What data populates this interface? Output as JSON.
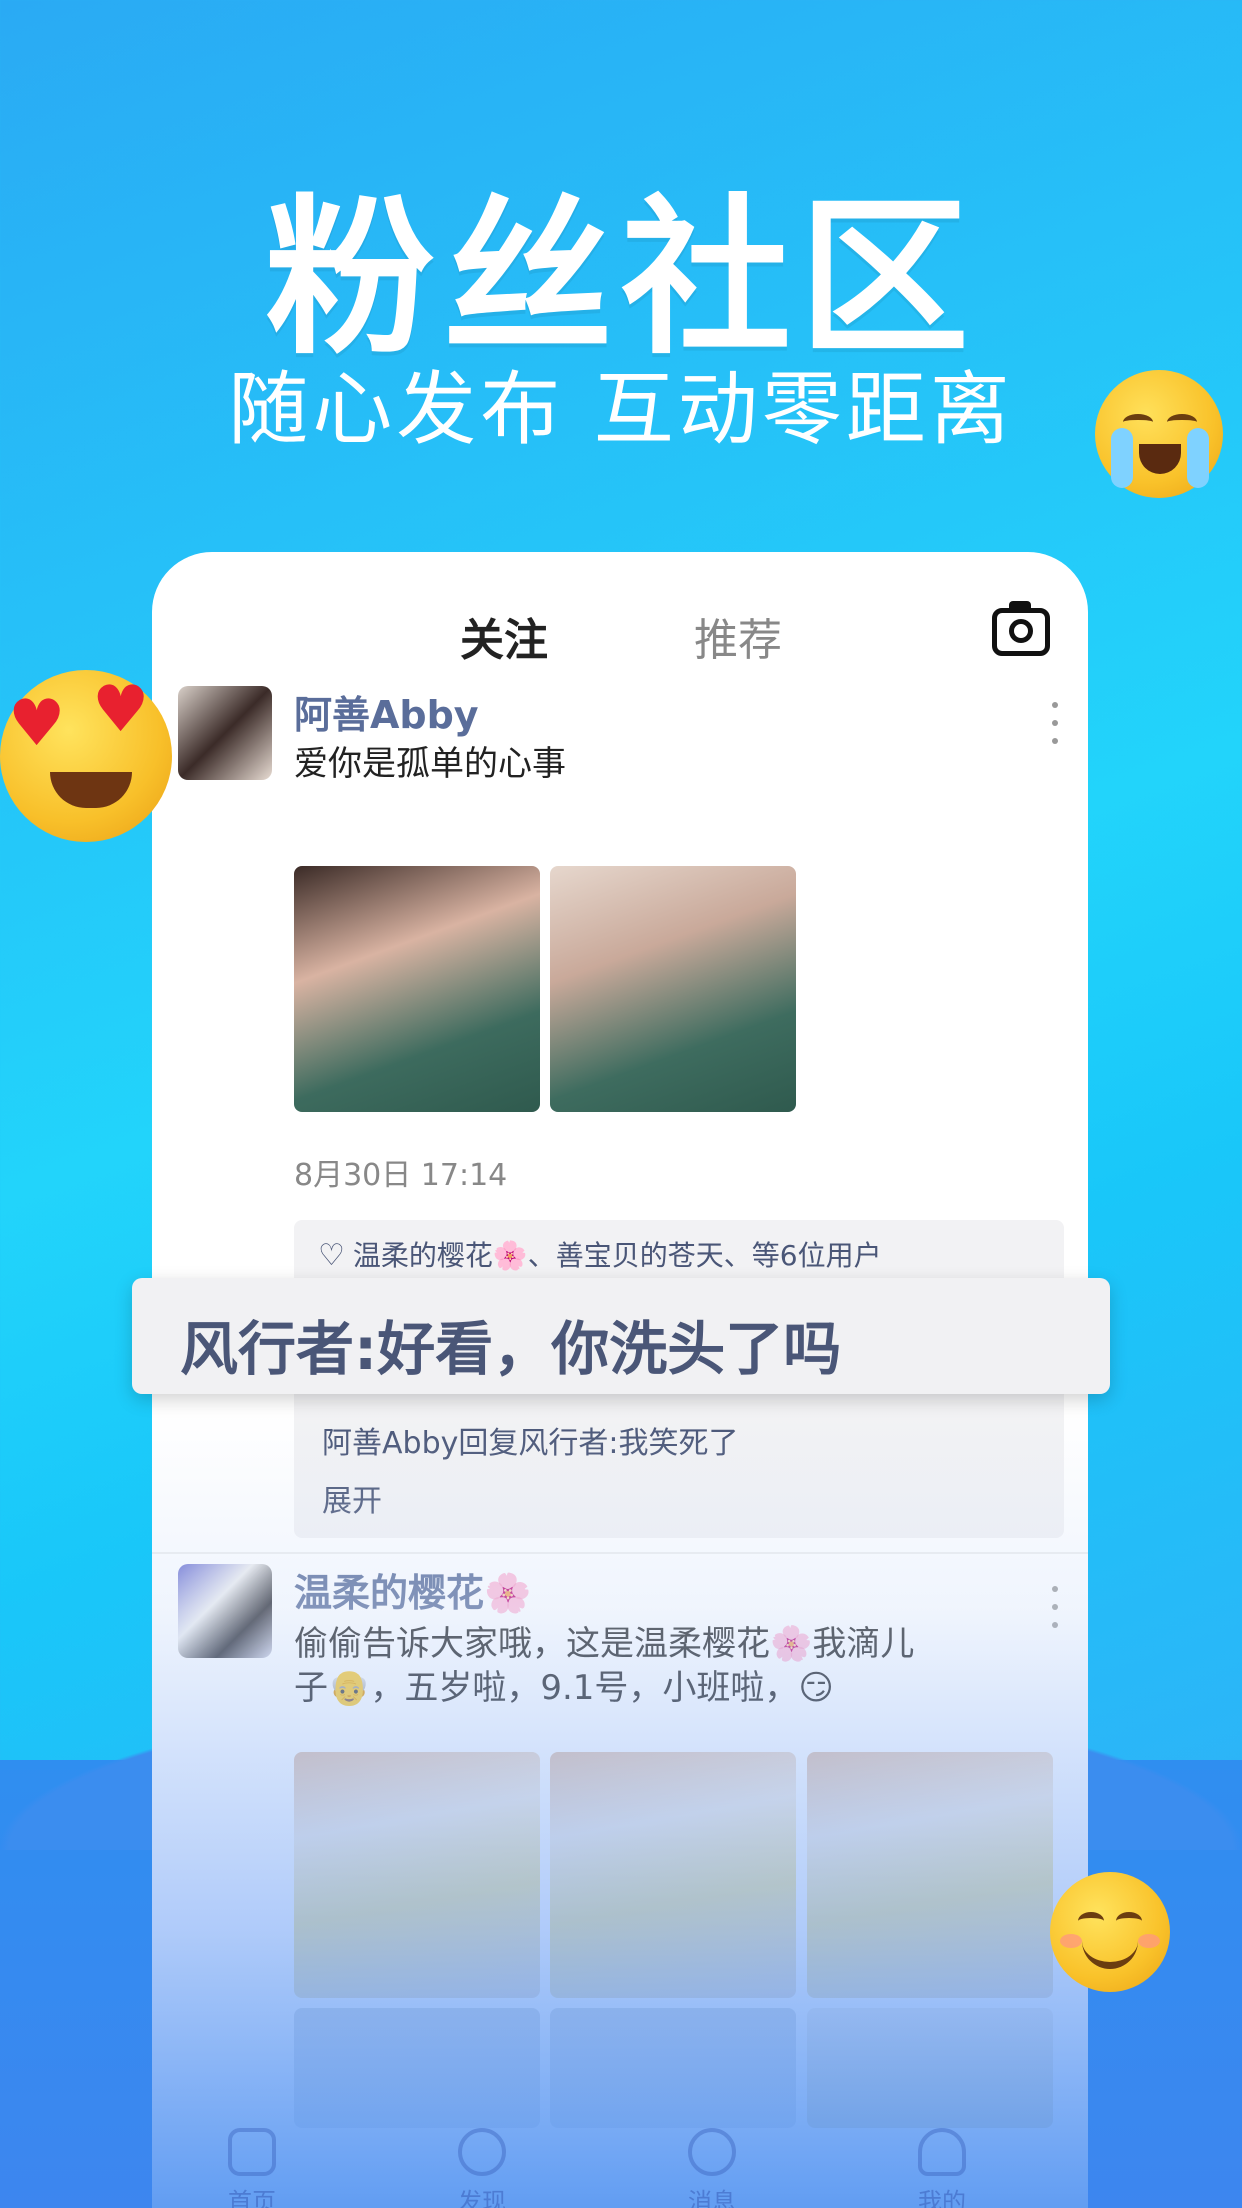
{
  "hero": {
    "title": "粉丝社区",
    "subtitle": "随心发布 互动零距离"
  },
  "feed_tabs": {
    "follow": "关注",
    "recommend": "推荐"
  },
  "post1": {
    "username": "阿善Abby",
    "text": "爱你是孤单的心事",
    "date": "8月30日 17:14",
    "likes": "温柔的樱花🌸、善宝贝的苍天、等6位用户",
    "reply": "阿善Abby回复风行者:我笑死了",
    "expand": "展开"
  },
  "callout": {
    "comment": "风行者:好看，你洗头了吗"
  },
  "post2": {
    "username": "温柔的樱花🌸",
    "text_line1": "偷偷告诉大家哦，这是温柔樱花🌸我滴儿",
    "text_line2": "子👴，五岁啦，9.1号，小班啦，😏"
  },
  "tabbar": {
    "home": "首页",
    "discover": "发现",
    "messages": "消息",
    "me": "我的"
  }
}
